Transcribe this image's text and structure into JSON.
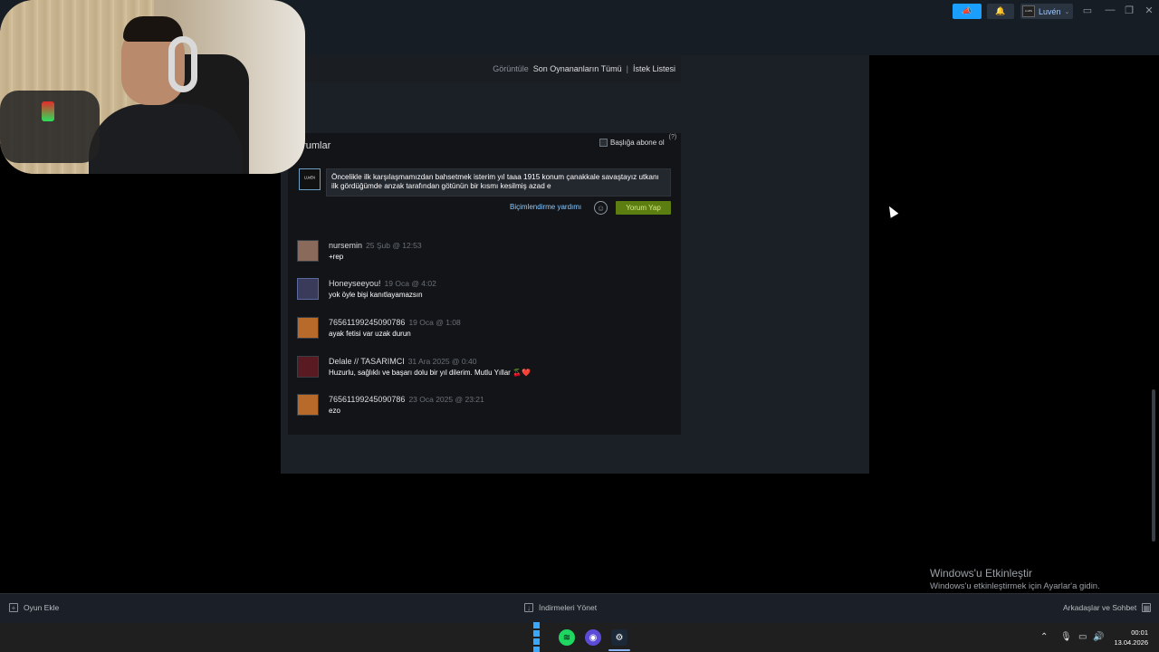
{
  "header": {
    "user_name": "Luvén",
    "user_avatar_text": "ᴸᵁᵛᴱᴺ",
    "window_controls": [
      "—",
      "❐",
      "✕"
    ]
  },
  "viewbar": {
    "label": "Görüntüle",
    "recent_all": "Son Oynananların Tümü",
    "separator": "|",
    "wishlist": "İstek Listesi"
  },
  "comments": {
    "title": "orumlar",
    "subscribe_label": "Başlığa abone ol",
    "subscribe_help": "(?)",
    "my_avatar_text": "ᴸᵁᵛᴱᴺ",
    "draft_text": "Öncelikle ilk karşılaşmamızdan bahsetmek isterim yıl taaa 1915 konum çanakkale savaştayız utkanı ilk gördüğümde anzak tarafından götünün bir kısmı kesilmiş azad e",
    "format_help": "Biçimlendirme yardımı",
    "emoji_icon": "☺",
    "post_button": "Yorum Yap",
    "items": [
      {
        "author": "nursemin",
        "time": "25 Şub @ 12:53",
        "text": "+rep",
        "avatar_color": "#8a6a5a"
      },
      {
        "author": "Honeyseeyou!",
        "time": "19 Oca @ 4:02",
        "text": "yok öyle bişi kanıtlayamazsın",
        "avatar_color": "#3a3a5a"
      },
      {
        "author": "76561199245090786",
        "time": "19 Oca @ 1:08",
        "text": "ayak fetisi var uzak durun",
        "avatar_color": "#b86a2a"
      },
      {
        "author": "Delale // TASARIMCI",
        "time": "31 Ara 2025 @ 0:40",
        "text": "Huzurlu, sağlıklı ve başarı dolu bir yıl dilerim. Mutlu Yıllar 🍒❤️",
        "avatar_color": "#5a1a22"
      },
      {
        "author": "76561199245090786",
        "time": "23 Oca 2025 @ 23:21",
        "text": "ezo",
        "avatar_color": "#b86a2a"
      }
    ]
  },
  "watermark": {
    "line1": "Windows'u Etkinleştir",
    "line2": "Windows'u etkinleştirmek için Ayarlar'a gidin."
  },
  "bottombar": {
    "add_game": "Oyun Ekle",
    "downloads": "İndirmeleri Yönet",
    "friends": "Arkadaşlar ve Sohbet"
  },
  "taskbar": {
    "time": "00:01",
    "date": "13.04.2026"
  },
  "colors": {
    "accent": "#1a9fff",
    "post_button": "#5c7e10",
    "link": "#8ccaff"
  }
}
